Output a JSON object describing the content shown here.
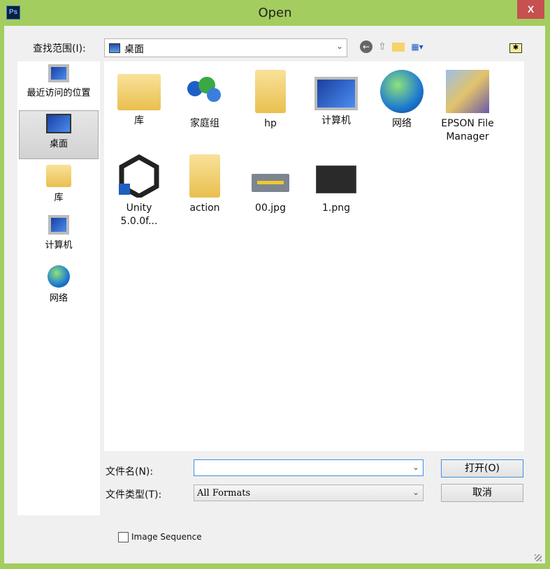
{
  "window": {
    "title": "Open",
    "app_icon": "Ps",
    "close": "X"
  },
  "lookin": {
    "label": "查找范围(I):",
    "value": "桌面"
  },
  "toolbar": {
    "back": "back-icon",
    "up": "up-folder-icon",
    "new_folder": "new-folder-icon",
    "view": "view-menu-icon"
  },
  "sidebar": {
    "items": [
      {
        "label": "最近访问的位置"
      },
      {
        "label": "桌面"
      },
      {
        "label": "库"
      },
      {
        "label": "计算机"
      },
      {
        "label": "网络"
      }
    ]
  },
  "files": [
    {
      "name": "库"
    },
    {
      "name": "家庭组"
    },
    {
      "name": "hp"
    },
    {
      "name": "计算机"
    },
    {
      "name": "网络"
    },
    {
      "name": "EPSON File Manager"
    },
    {
      "name": "Unity 5.0.0f..."
    },
    {
      "name": "action"
    },
    {
      "name": "00.jpg"
    },
    {
      "name": "1.png"
    }
  ],
  "filename": {
    "label": "文件名(N):",
    "value": ""
  },
  "filetype": {
    "label": "文件类型(T):",
    "value": "All Formats"
  },
  "buttons": {
    "open": "打开(O)",
    "cancel": "取消"
  },
  "image_sequence": {
    "label": "Image Sequence",
    "checked": false
  }
}
